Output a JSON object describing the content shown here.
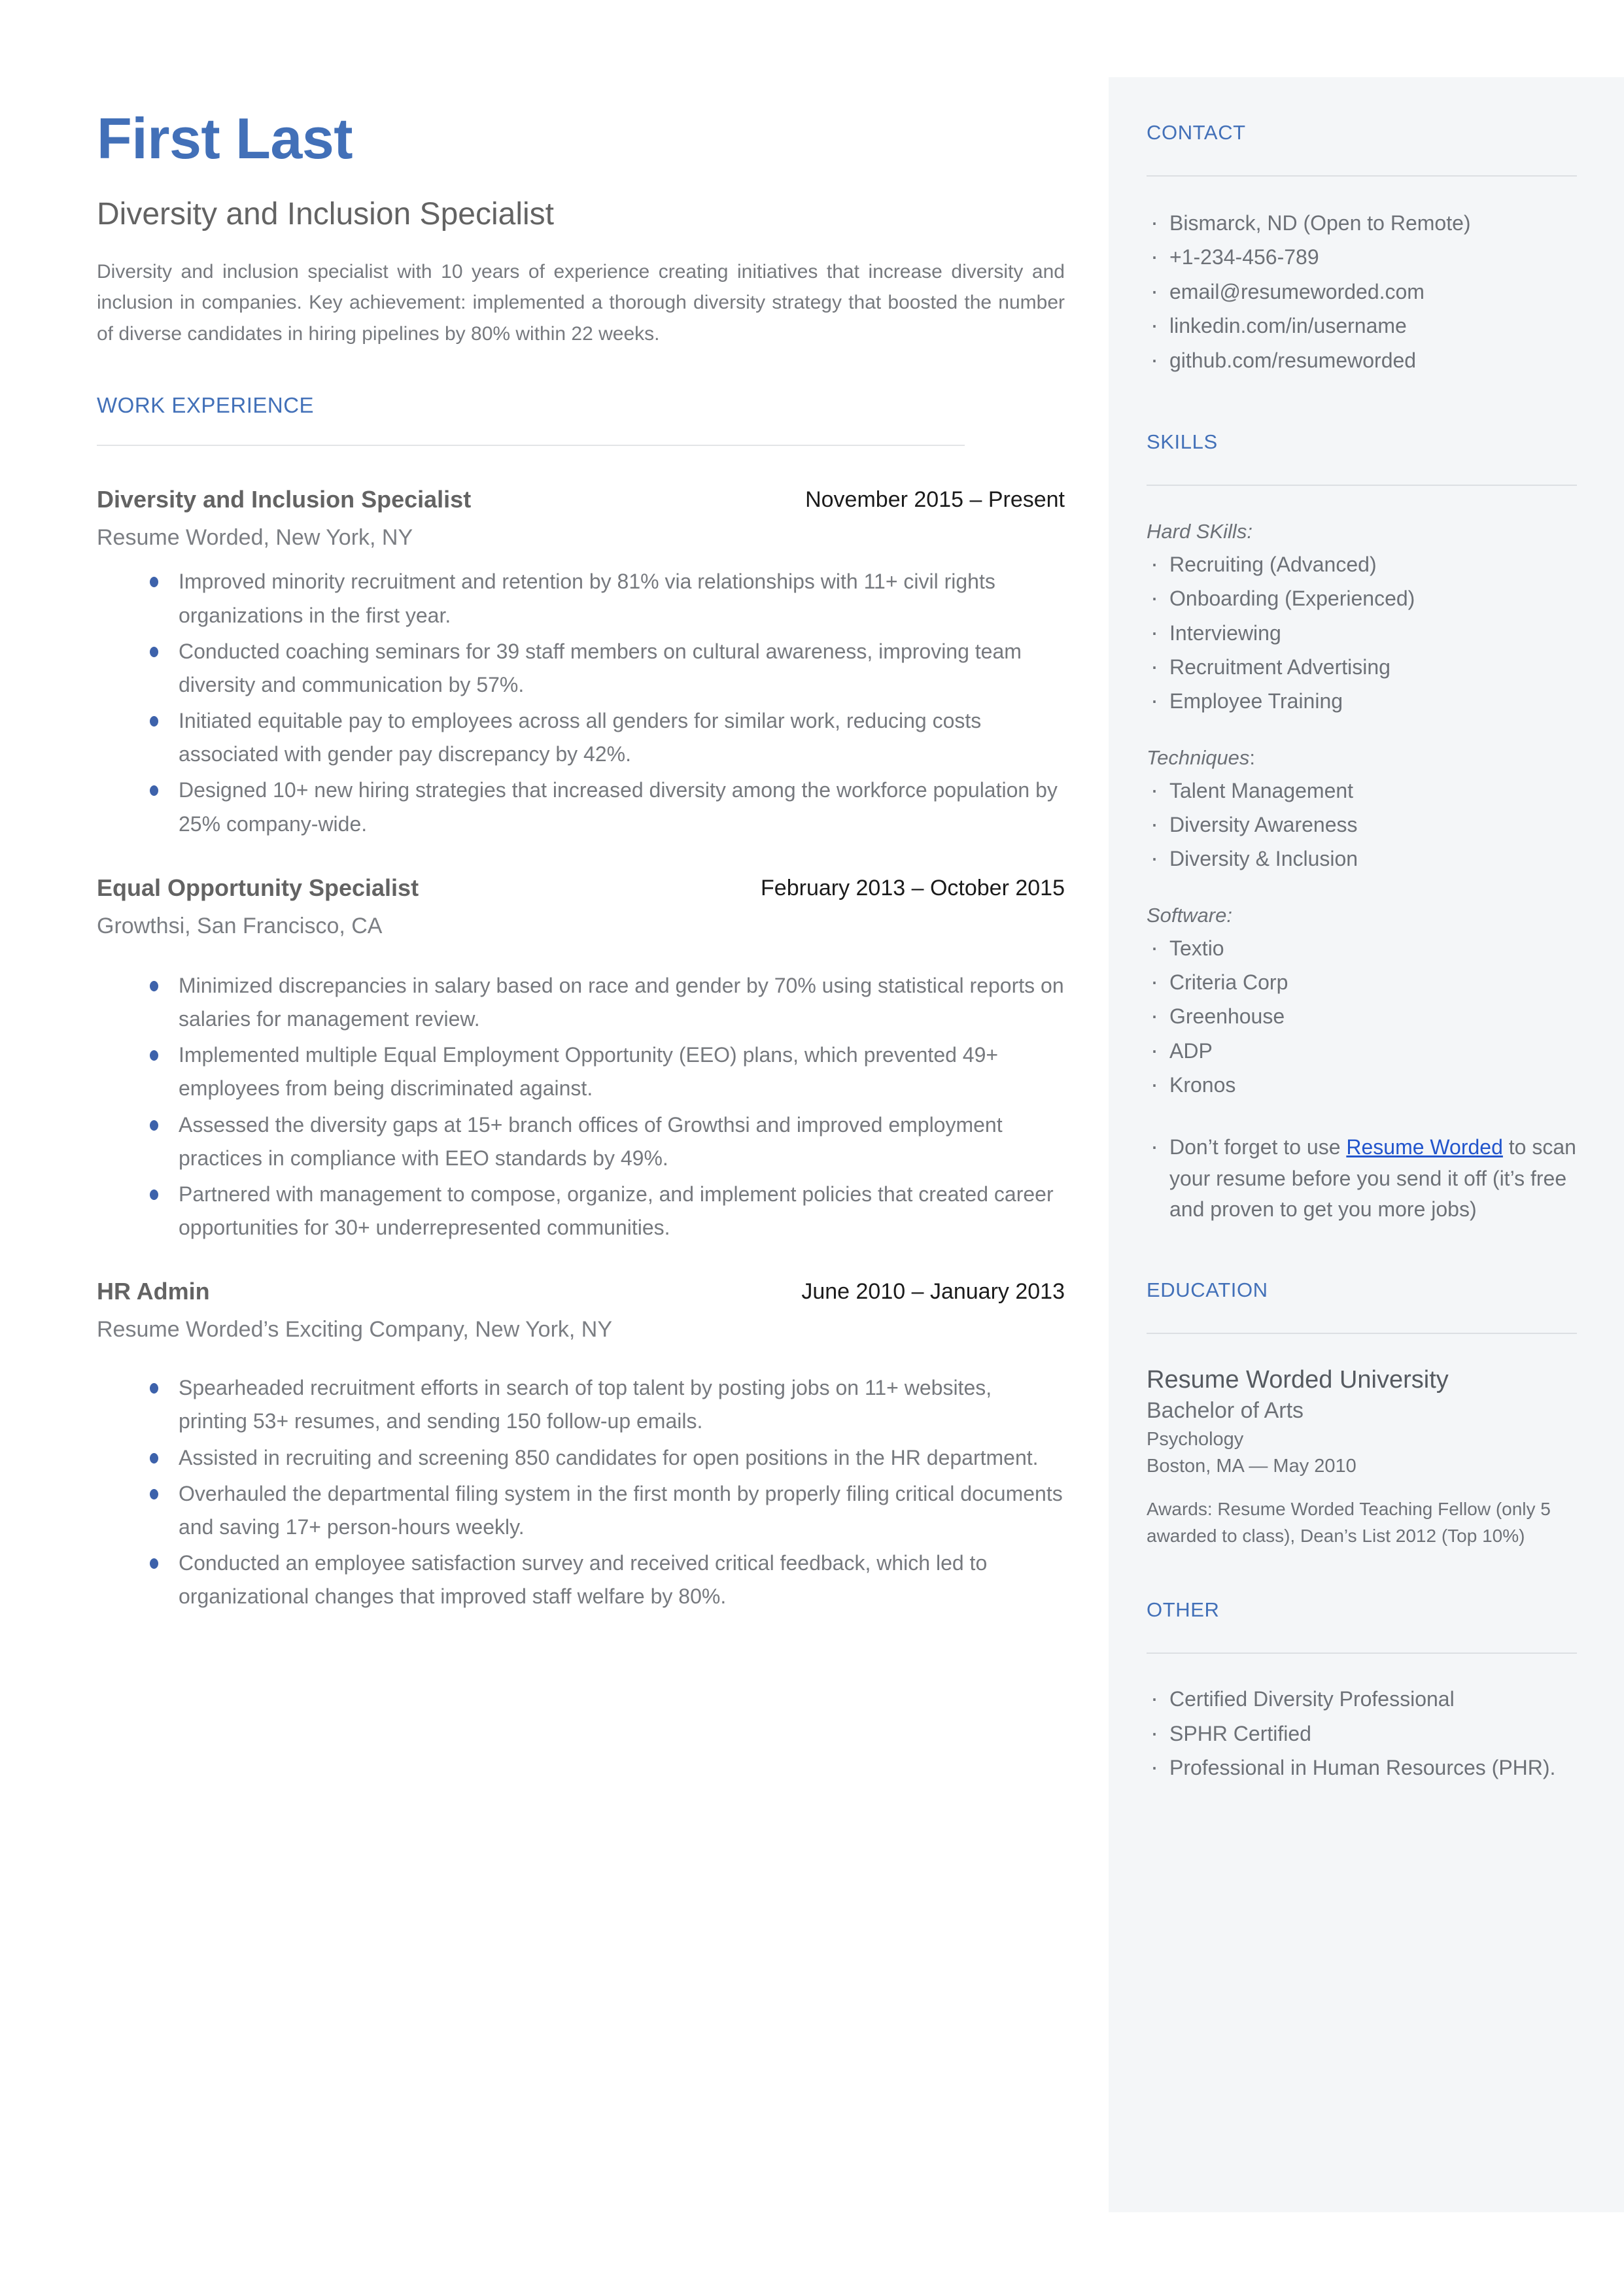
{
  "header": {
    "name": "First Last",
    "headline": "Diversity and Inclusion Specialist",
    "summary": "Diversity and inclusion specialist with 10 years of experience creating initiatives that increase diversity and inclusion in companies. Key achievement: implemented a thorough diversity strategy that boosted the number of diverse candidates in hiring pipelines by 80% within 22 weeks."
  },
  "work": {
    "section_title": "WORK EXPERIENCE",
    "jobs": [
      {
        "title": "Diversity and Inclusion Specialist",
        "dates": "November 2015 – Present",
        "company": "Resume Worded, New York, NY",
        "bullets": [
          "Improved minority recruitment and retention by 81% via relationships with 11+ civil rights organizations in the first year.",
          "Conducted coaching seminars for 39 staff members on cultural awareness, improving team diversity and communication by 57%.",
          "Initiated equitable pay to employees across all genders for similar work, reducing costs associated with gender pay discrepancy by 42%.",
          "Designed 10+ new hiring strategies that increased diversity among the workforce population by 25% company-wide."
        ]
      },
      {
        "title": "Equal Opportunity Specialist",
        "dates": "February 2013 – October 2015",
        "company": "Growthsi, San Francisco, CA",
        "bullets": [
          "Minimized discrepancies in salary based on race and gender by 70% using statistical reports on salaries for management review.",
          "Implemented multiple Equal Employment Opportunity (EEO) plans, which prevented 49+ employees from being discriminated against.",
          "Assessed the diversity gaps at 15+ branch offices of Growthsi and improved employment practices in compliance with EEO standards by 49%.",
          "Partnered with management to compose, organize, and implement policies that created career opportunities for 30+ underrepresented communities."
        ]
      },
      {
        "title": "HR Admin",
        "dates": "June 2010 – January 2013",
        "company": "Resume Worded’s Exciting Company, New York, NY",
        "bullets": [
          "Spearheaded recruitment efforts in search of top talent by posting jobs on 11+ websites, printing 53+ resumes, and sending 150 follow-up emails.",
          "Assisted in recruiting and screening 850 candidates for open positions in the HR department.",
          "Overhauled the departmental filing system in the first month by properly filing critical documents and saving 17+ person-hours weekly.",
          "Conducted an employee satisfaction survey and received critical feedback, which led to organizational changes that improved staff welfare by 80%."
        ]
      }
    ]
  },
  "contact": {
    "section_title": "CONTACT",
    "items": [
      "Bismarck, ND (Open to Remote)",
      "+1-234-456-789",
      "email@resumeworded.com",
      "linkedin.com/in/username",
      "github.com/resumeworded"
    ]
  },
  "skills": {
    "section_title": "SKILLS",
    "groups": [
      {
        "label": "Hard SKills:",
        "label_main": "Hard SKills:",
        "label_tail": "",
        "items": [
          "Recruiting (Advanced)",
          "Onboarding (Experienced)",
          "Interviewing",
          "Recruitment Advertising",
          "Employee Training"
        ]
      },
      {
        "label": "Techniques:",
        "label_main": "Techniques",
        "label_tail": ":",
        "items": [
          "Talent Management",
          "Diversity Awareness",
          "Diversity & Inclusion"
        ]
      },
      {
        "label": "Software:",
        "label_main": "Software:",
        "label_tail": "",
        "items": [
          "Textio",
          "Criteria Corp",
          "Greenhouse",
          "ADP",
          "Kronos"
        ]
      }
    ],
    "promo": {
      "prefix": "Don’t forget to use ",
      "link": "Resume Worded",
      "suffix": " to scan your resume before you send it off (it’s free and proven to get you more jobs)"
    }
  },
  "education": {
    "section_title": "EDUCATION",
    "school": "Resume Worded University",
    "degree": "Bachelor of Arts",
    "field": "Psychology",
    "location_date": "Boston, MA — May 2010",
    "awards": "Awards: Resume Worded Teaching Fellow (only 5 awarded to class), Dean’s List 2012 (Top 10%)"
  },
  "other": {
    "section_title": "OTHER",
    "items": [
      "Certified Diversity Professional",
      "SPHR Certified",
      "Professional in Human Resources (PHR)."
    ]
  },
  "colors": {
    "accent": "#4270b8",
    "bullet": "#3d62ab",
    "link": "#2255cc",
    "sidebar_bg": "#f4f6f8",
    "body_text": "#76797e"
  }
}
